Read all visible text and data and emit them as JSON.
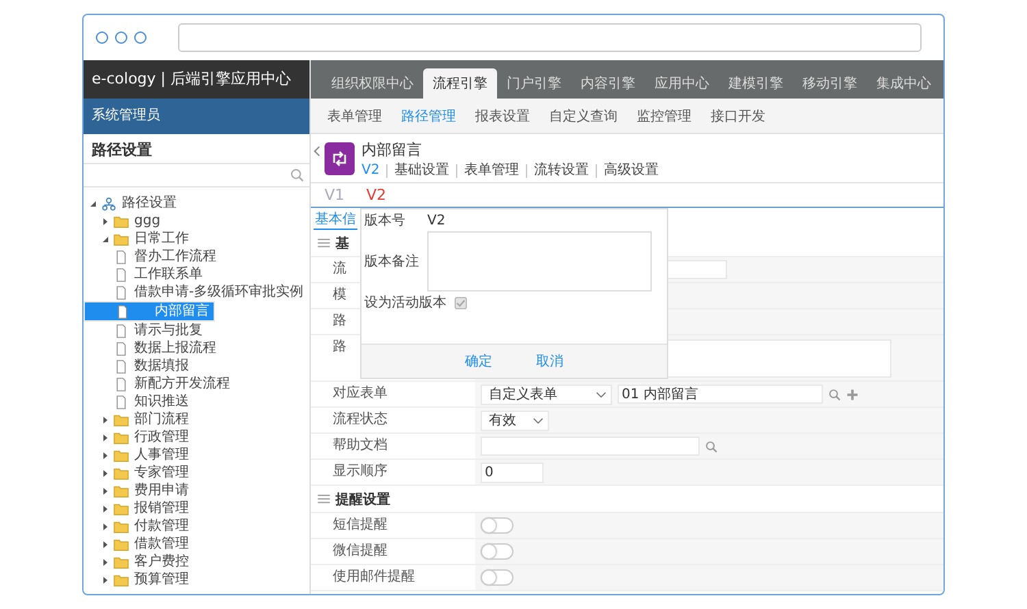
{
  "header": {
    "logo": "e-cology | 后端引擎应用中心",
    "user": "系统管理员"
  },
  "top_tabs": [
    {
      "label": "组织权限中心",
      "selected": false
    },
    {
      "label": "流程引擎",
      "selected": true
    },
    {
      "label": "门户引擎",
      "selected": false
    },
    {
      "label": "内容引擎",
      "selected": false
    },
    {
      "label": "应用中心",
      "selected": false
    },
    {
      "label": "建模引擎",
      "selected": false
    },
    {
      "label": "移动引擎",
      "selected": false
    },
    {
      "label": "集成中心",
      "selected": false
    }
  ],
  "sub_tabs": [
    {
      "label": "表单管理",
      "selected": false
    },
    {
      "label": "路径管理",
      "selected": true
    },
    {
      "label": "报表设置",
      "selected": false
    },
    {
      "label": "自定义查询",
      "selected": false
    },
    {
      "label": "监控管理",
      "selected": false
    },
    {
      "label": "接口开发",
      "selected": false
    }
  ],
  "sidebar": {
    "title": "路径设置",
    "tree": [
      {
        "label": "路径设置",
        "kind": "root",
        "expanded": true,
        "selected": false,
        "children": [
          {
            "label": "ggg",
            "kind": "folder",
            "expanded": false,
            "selected": false
          },
          {
            "label": "日常工作",
            "kind": "folder",
            "expanded": true,
            "selected": false,
            "children": [
              {
                "label": "督办工作流程",
                "kind": "doc",
                "selected": false
              },
              {
                "label": "工作联系单",
                "kind": "doc",
                "selected": false
              },
              {
                "label": "借款申请-多级循环审批实例",
                "kind": "doc",
                "selected": false
              },
              {
                "label": "内部留言",
                "kind": "doc",
                "selected": true
              },
              {
                "label": "请示与批复",
                "kind": "doc",
                "selected": false
              },
              {
                "label": "数据上报流程",
                "kind": "doc",
                "selected": false
              },
              {
                "label": "数据填报",
                "kind": "doc",
                "selected": false
              },
              {
                "label": "新配方开发流程",
                "kind": "doc",
                "selected": false
              },
              {
                "label": "知识推送",
                "kind": "doc",
                "selected": false
              }
            ]
          },
          {
            "label": "部门流程",
            "kind": "folder",
            "expanded": false,
            "selected": false
          },
          {
            "label": "行政管理",
            "kind": "folder",
            "expanded": false,
            "selected": false
          },
          {
            "label": "人事管理",
            "kind": "folder",
            "expanded": false,
            "selected": false
          },
          {
            "label": "专家管理",
            "kind": "folder",
            "expanded": false,
            "selected": false
          },
          {
            "label": "费用申请",
            "kind": "folder",
            "expanded": false,
            "selected": false
          },
          {
            "label": "报销管理",
            "kind": "folder",
            "expanded": false,
            "selected": false
          },
          {
            "label": "付款管理",
            "kind": "folder",
            "expanded": false,
            "selected": false
          },
          {
            "label": "借款管理",
            "kind": "folder",
            "expanded": false,
            "selected": false
          },
          {
            "label": "客户费控",
            "kind": "folder",
            "expanded": false,
            "selected": false
          },
          {
            "label": "预算管理",
            "kind": "folder",
            "expanded": false,
            "selected": false
          }
        ]
      }
    ]
  },
  "workflow": {
    "title": "内部留言",
    "links": [
      {
        "label": "V2",
        "selected": true
      },
      {
        "label": "基础设置",
        "selected": false
      },
      {
        "label": "表单管理",
        "selected": false
      },
      {
        "label": "流转设置",
        "selected": false
      },
      {
        "label": "高级设置",
        "selected": false
      }
    ]
  },
  "versions": [
    {
      "label": "V1",
      "selected": false
    },
    {
      "label": "V2",
      "selected": true
    }
  ],
  "side_tab": {
    "label": "基本信",
    "selected": true
  },
  "section_1": {
    "title": "基",
    "rows": [
      {
        "label": "流",
        "kind": "input"
      },
      {
        "label": "模",
        "kind": "blank"
      },
      {
        "label": "路",
        "kind": "blank"
      },
      {
        "label": "路",
        "kind": "textarea"
      },
      {
        "label": "对应表单",
        "kind": "form-select",
        "select": "自定义表单",
        "value": "01 内部留言"
      },
      {
        "label": "流程状态",
        "kind": "select",
        "select": "有效"
      },
      {
        "label": "帮助文档",
        "kind": "search-input"
      },
      {
        "label": "显示顺序",
        "kind": "input",
        "value": "0"
      }
    ]
  },
  "section_2": {
    "title": "提醒设置",
    "rows": [
      {
        "label": "短信提醒",
        "on": false
      },
      {
        "label": "微信提醒",
        "on": false
      },
      {
        "label": "使用邮件提醒",
        "on": false
      }
    ]
  },
  "dialog": {
    "version_label": "版本号",
    "version": "V2",
    "note_label": "版本备注",
    "active_label": "设为活动版本",
    "active_checked": true,
    "active_disabled": true,
    "buttons": [
      "确定",
      "取消"
    ]
  }
}
